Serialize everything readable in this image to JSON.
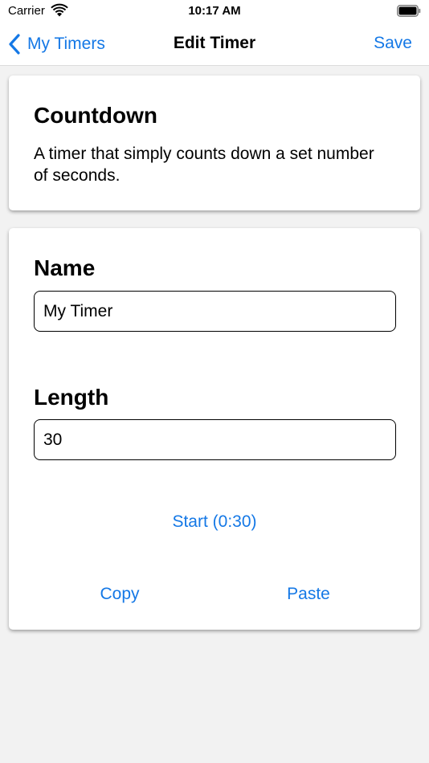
{
  "status_bar": {
    "carrier": "Carrier",
    "time": "10:17 AM",
    "wifi_icon": "wifi-icon",
    "battery_icon": "battery-icon"
  },
  "nav_bar": {
    "back_label": "My Timers",
    "back_icon": "chevron-left-icon",
    "title": "Edit Timer",
    "save_label": "Save"
  },
  "info_card": {
    "title": "Countdown",
    "description": "A timer that simply counts down a set number of seconds."
  },
  "form": {
    "name_label": "Name",
    "name_value": "My Timer",
    "length_label": "Length",
    "length_value": "30",
    "start_label": "Start (0:30)",
    "copy_label": "Copy",
    "paste_label": "Paste"
  },
  "colors": {
    "accent": "#1478e6",
    "background": "#f2f2f2",
    "card": "#ffffff"
  }
}
